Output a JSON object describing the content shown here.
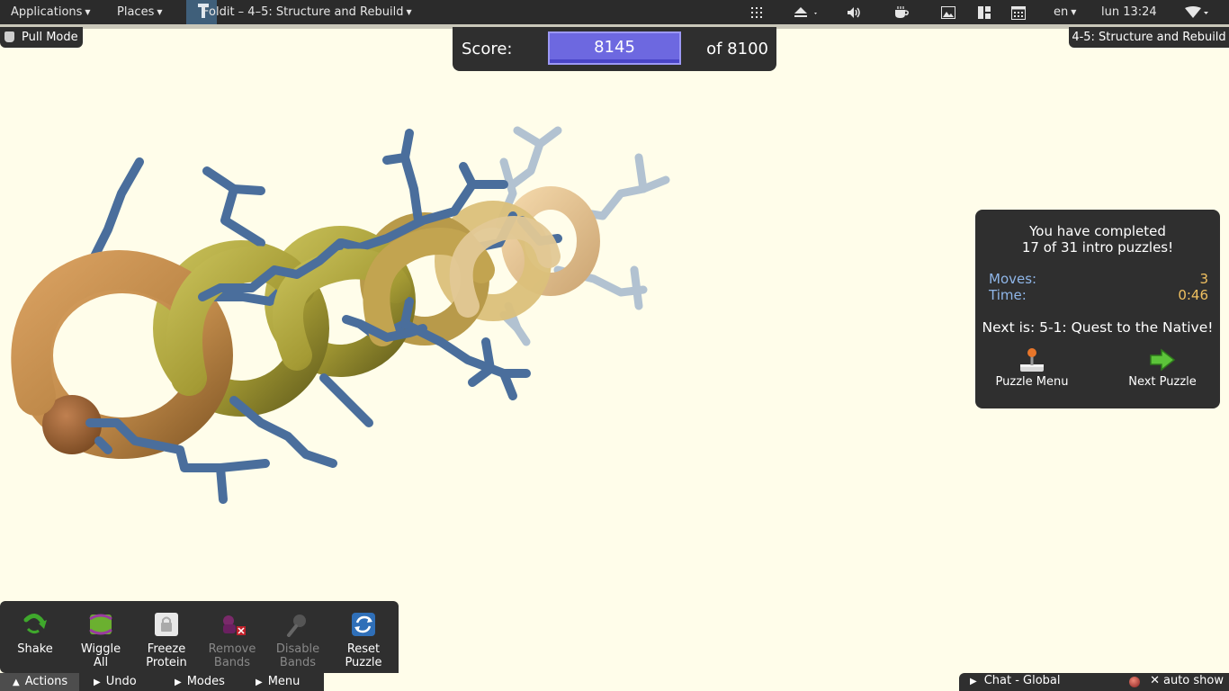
{
  "topbar": {
    "applications": "Applications",
    "places": "Places",
    "window_title": "Foldit – 4–5: Structure and Rebuild",
    "language": "en",
    "clock": "lun 13:24",
    "icons": [
      "apps-grid-icon",
      "eject-icon",
      "volume-icon",
      "coffee-icon",
      "image-icon",
      "layout-icon",
      "calendar-icon",
      "wifi-icon"
    ]
  },
  "pull_mode": {
    "label": "Pull Mode",
    "icon": "hand-icon"
  },
  "puzzle_name": "4-5: Structure and Rebuild",
  "score": {
    "label": "Score:",
    "value": "8145",
    "target": "of 8100"
  },
  "completion": {
    "line1": "You have completed",
    "line2": "17 of 31 intro puzzles!",
    "moves_label": "Moves:",
    "moves_value": "3",
    "time_label": "Time:",
    "time_value": "0:46",
    "next": "Next is: 5-1: Quest to the Native!",
    "menu_button": "Puzzle Menu",
    "next_button": "Next Puzzle"
  },
  "actions": [
    {
      "l1": "Shake",
      "l2": ""
    },
    {
      "l1": "Wiggle",
      "l2": "All"
    },
    {
      "l1": "Freeze",
      "l2": "Protein"
    },
    {
      "l1": "Remove",
      "l2": "Bands"
    },
    {
      "l1": "Disable",
      "l2": "Bands"
    },
    {
      "l1": "Reset",
      "l2": "Puzzle"
    }
  ],
  "tabs": [
    "Actions",
    "Undo",
    "Modes",
    "Menu"
  ],
  "chat": {
    "label": "Chat - Global",
    "auto_show": "auto show"
  },
  "colors": {
    "background": "#fffdea",
    "panel": "#2f2f2f",
    "score_fill": "#6d68e0",
    "sidechain": "#4a6e9c",
    "helix": "#a8a23a"
  }
}
